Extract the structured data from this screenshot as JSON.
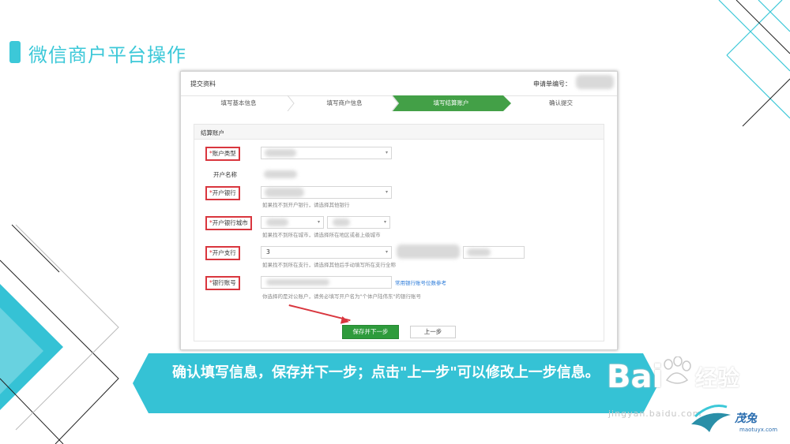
{
  "slide": {
    "title": "微信商户平台操作",
    "caption": "确认填写信息，保存并下一步；点击\"上一步\"可以修改上一步信息。"
  },
  "screenshot": {
    "header_title": "提交资料",
    "application_no_label": "申请单编号：",
    "steps": [
      "填写基本信息",
      "填写商户信息",
      "填写结算账户",
      "确认提交"
    ],
    "active_step": 3,
    "section_title": "结算账户",
    "fields": {
      "account_type": "账户类型",
      "account_name": "开户名称",
      "bank": "开户银行",
      "bank_hint": "如果找不到开户银行，请选择其他银行",
      "bank_city": "开户银行城市",
      "city_hint": "如果找不到所在城市，请选择所在地区或者上级城市",
      "branch": "开户支行",
      "branch_value": "3",
      "branch_hint": "如果找不到所在支行，请选择其他后手动填写所在支行全称",
      "account_no": "银行账号",
      "account_no_link": "常用银行账号位数参考",
      "account_no_hint": "你选择的是对公账户，请务必填写开户名为\"个体户陆伟东\"的银行账号",
      "required_mark": "*"
    },
    "buttons": {
      "save_next": "保存并下一步",
      "previous": "上一步"
    }
  },
  "watermark": {
    "brand": "Bai",
    "brand2": "经验",
    "url": "jingyan.baidu.com",
    "logo": "茂兔",
    "logo_url": "maotuyx.com"
  },
  "colors": {
    "accent": "#3cc8d8",
    "step_active": "#43a047",
    "button_primary": "#2e9b3c",
    "highlight": "#d9363e"
  }
}
